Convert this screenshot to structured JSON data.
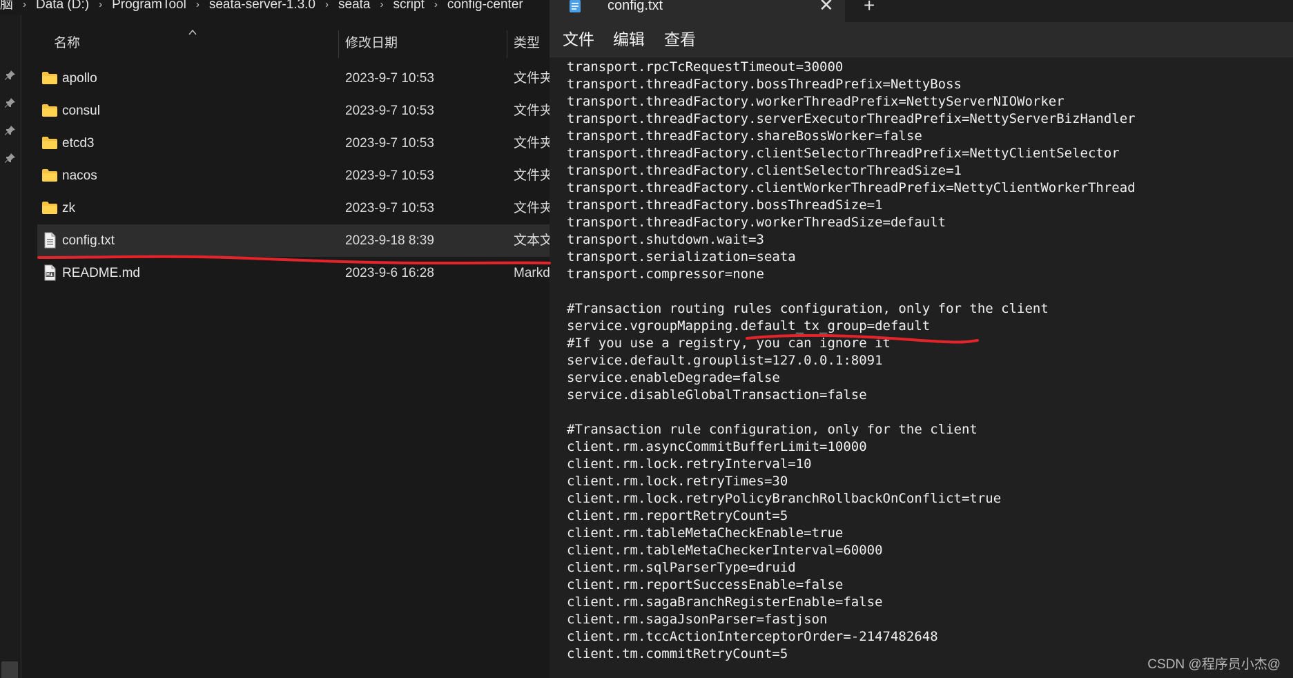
{
  "explorer": {
    "breadcrumb": [
      "脑",
      "Data (D:)",
      "ProgramTool",
      "seata-server-1.3.0",
      "seata",
      "script",
      "config-center"
    ],
    "breadcrumb_separator": "›",
    "columns": {
      "name": "名称",
      "modified": "修改日期",
      "type": "类型"
    },
    "files": [
      {
        "name": "apollo",
        "date": "2023-9-7 10:53",
        "type": "文件夹",
        "icon": "folder-icon"
      },
      {
        "name": "consul",
        "date": "2023-9-7 10:53",
        "type": "文件夹",
        "icon": "folder-icon"
      },
      {
        "name": "etcd3",
        "date": "2023-9-7 10:53",
        "type": "文件夹",
        "icon": "folder-icon"
      },
      {
        "name": "nacos",
        "date": "2023-9-7 10:53",
        "type": "文件夹",
        "icon": "folder-icon"
      },
      {
        "name": "zk",
        "date": "2023-9-7 10:53",
        "type": "文件夹",
        "icon": "folder-icon"
      },
      {
        "name": "config.txt",
        "date": "2023-9-18 8:39",
        "type": "文本文档",
        "icon": "text-file-icon",
        "selected": true
      },
      {
        "name": "README.md",
        "date": "2023-9-6 16:28",
        "type": "Markdown",
        "icon": "markdown-file-icon"
      }
    ]
  },
  "notepad": {
    "tab_title": "config.txt",
    "close_glyph": "✕",
    "new_tab_glyph": "+",
    "menu": {
      "file": "文件",
      "edit": "编辑",
      "view": "查看"
    },
    "lines": [
      "transport.rpcTcRequestTimeout=30000",
      "transport.threadFactory.bossThreadPrefix=NettyBoss",
      "transport.threadFactory.workerThreadPrefix=NettyServerNIOWorker",
      "transport.threadFactory.serverExecutorThreadPrefix=NettyServerBizHandler",
      "transport.threadFactory.shareBossWorker=false",
      "transport.threadFactory.clientSelectorThreadPrefix=NettyClientSelector",
      "transport.threadFactory.clientSelectorThreadSize=1",
      "transport.threadFactory.clientWorkerThreadPrefix=NettyClientWorkerThread",
      "transport.threadFactory.bossThreadSize=1",
      "transport.threadFactory.workerThreadSize=default",
      "transport.shutdown.wait=3",
      "transport.serialization=seata",
      "transport.compressor=none",
      "",
      "#Transaction routing rules configuration, only for the client",
      "service.vgroupMapping.default_tx_group=default",
      "#If you use a registry, you can ignore it",
      "service.default.grouplist=127.0.0.1:8091",
      "service.enableDegrade=false",
      "service.disableGlobalTransaction=false",
      "",
      "#Transaction rule configuration, only for the client",
      "client.rm.asyncCommitBufferLimit=10000",
      "client.rm.lock.retryInterval=10",
      "client.rm.lock.retryTimes=30",
      "client.rm.lock.retryPolicyBranchRollbackOnConflict=true",
      "client.rm.reportRetryCount=5",
      "client.rm.tableMetaCheckEnable=true",
      "client.rm.tableMetaCheckerInterval=60000",
      "client.rm.sqlParserType=druid",
      "client.rm.reportSuccessEnable=false",
      "client.rm.sagaBranchRegisterEnable=false",
      "client.rm.sagaJsonParser=fastjson",
      "client.rm.tccActionInterceptorOrder=-2147482648",
      "client.tm.commitRetryCount=5"
    ]
  },
  "watermark": "CSDN @程序员小杰@",
  "colors": {
    "folder": "#f5c242",
    "annotation": "#e3242b",
    "accent_doc_icon": "#4a9fe8"
  }
}
